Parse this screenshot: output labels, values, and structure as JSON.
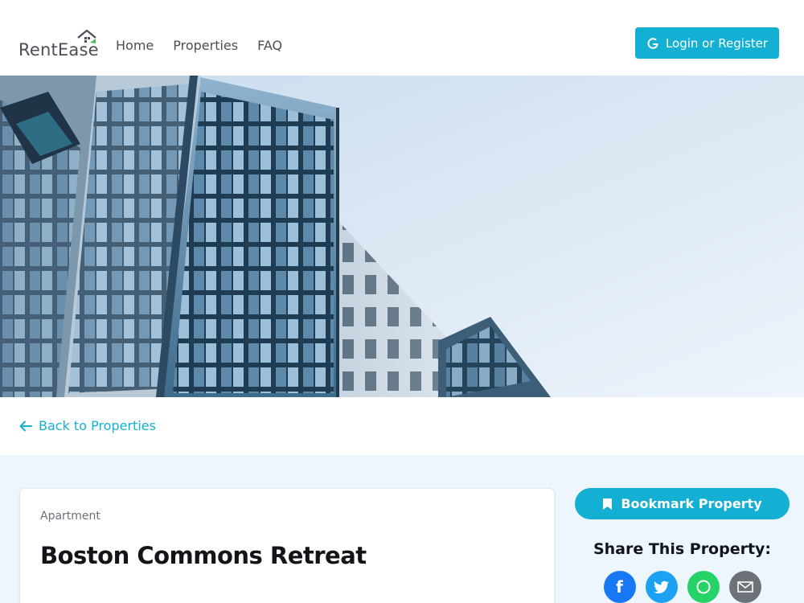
{
  "header": {
    "logo_text": "RentEase",
    "nav": [
      {
        "label": "Home"
      },
      {
        "label": "Properties"
      },
      {
        "label": "FAQ"
      }
    ],
    "login_label": "Login or Register"
  },
  "hero": {
    "image": "building-facade-photo"
  },
  "back_link": {
    "label": "Back to Properties"
  },
  "property": {
    "type": "Apartment",
    "title": "Boston Commons Retreat"
  },
  "sidebar": {
    "bookmark_label": "Bookmark Property",
    "share_title": "Share This Property:",
    "share_buttons": [
      {
        "icon": "facebook-icon",
        "color": "#1877f2"
      },
      {
        "icon": "twitter-icon",
        "color": "#1da1f2"
      },
      {
        "icon": "whatsapp-icon",
        "color": "#25d366"
      },
      {
        "icon": "email-icon",
        "color": "#6c7278"
      }
    ]
  },
  "colors": {
    "accent": "#14b0d3",
    "content_bg": "#eef6fd"
  }
}
